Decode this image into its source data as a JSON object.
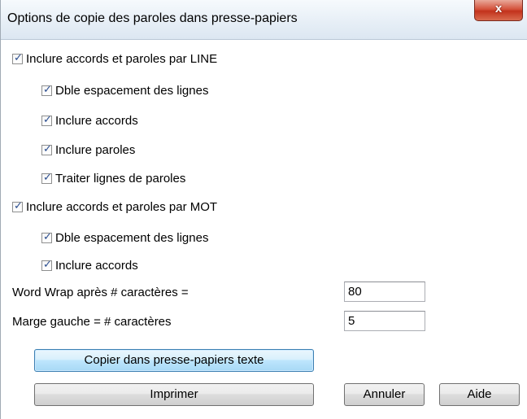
{
  "window": {
    "title": "Options de copie des paroles dans presse-papiers",
    "close_label": "x"
  },
  "options": {
    "line_group": {
      "label": "Inclure accords et paroles par LINE",
      "checked": true,
      "children": [
        {
          "label": "Dble espacement des lignes",
          "checked": true
        },
        {
          "label": "Inclure accords",
          "checked": true
        },
        {
          "label": "Inclure paroles",
          "checked": true
        },
        {
          "label": "Traiter lignes de paroles",
          "checked": true
        }
      ]
    },
    "word_group": {
      "label": "Inclure accords et paroles par MOT",
      "checked": true,
      "children": [
        {
          "label": "Dble espacement des lignes",
          "checked": true
        },
        {
          "label": "Inclure accords",
          "checked": true
        }
      ]
    }
  },
  "fields": {
    "word_wrap": {
      "label": "Word Wrap après # caractères =",
      "value": "80"
    },
    "left_margin": {
      "label": "Marge gauche = # caractères",
      "value": "5"
    }
  },
  "buttons": {
    "copy_text": "Copier dans presse-papiers texte",
    "print": "Imprimer",
    "cancel": "Annuler",
    "help": "Aide"
  },
  "check_glyph": "✓"
}
